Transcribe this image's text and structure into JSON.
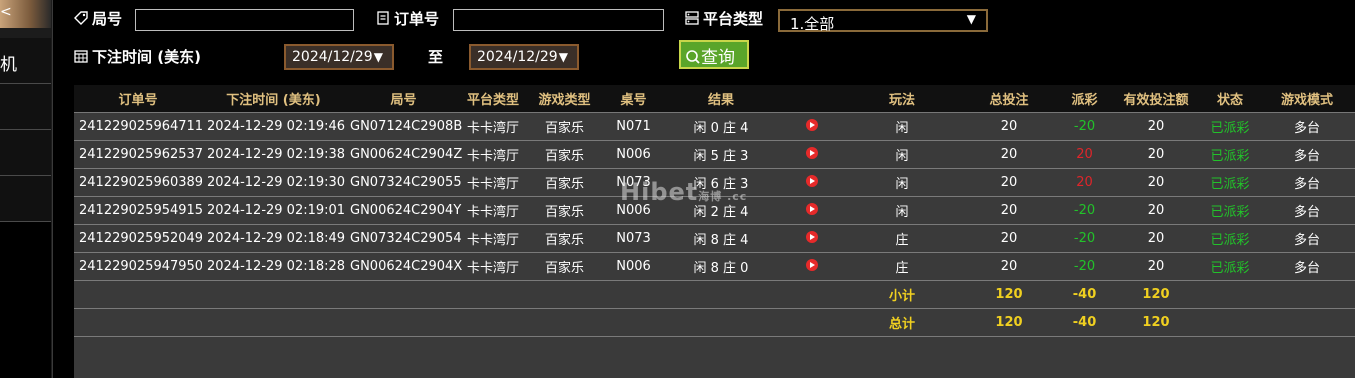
{
  "sidebar": {
    "item1": "机",
    "top_arrow": "<"
  },
  "filters": {
    "game_no_label": "局号",
    "order_no_label": "订单号",
    "platform_label": "平台类型",
    "platform_value": "1.全部",
    "bet_time_label": "下注时间 (美东)",
    "date_from": "2024/12/29",
    "to_label": "至",
    "date_to": "2024/12/29",
    "query_label": "查询"
  },
  "table": {
    "headers": [
      "订单号",
      "下注时间 (美东)",
      "局号",
      "平台类型",
      "游戏类型",
      "桌号",
      "结果",
      "",
      "玩法",
      "总投注",
      "派彩",
      "有效投注额",
      "状态",
      "游戏模式"
    ],
    "rows": [
      {
        "order": "241229025964711",
        "time": "2024-12-29 02:19:46",
        "game": "GN07124C2908B",
        "platform": "卡卡湾厅",
        "type": "百家乐",
        "table": "N071",
        "result": "闲 0 庄 4",
        "play": "闲",
        "bet": "20",
        "payout": "-20",
        "payout_color": "green",
        "valid": "20",
        "status": "已派彩",
        "mode": "多台"
      },
      {
        "order": "241229025962537",
        "time": "2024-12-29 02:19:38",
        "game": "GN00624C2904Z",
        "platform": "卡卡湾厅",
        "type": "百家乐",
        "table": "N006",
        "result": "闲 5 庄 3",
        "play": "闲",
        "bet": "20",
        "payout": "20",
        "payout_color": "red",
        "valid": "20",
        "status": "已派彩",
        "mode": "多台"
      },
      {
        "order": "241229025960389",
        "time": "2024-12-29 02:19:30",
        "game": "GN07324C29055",
        "platform": "卡卡湾厅",
        "type": "百家乐",
        "table": "N073",
        "result": "闲 6 庄 3",
        "play": "闲",
        "bet": "20",
        "payout": "20",
        "payout_color": "red",
        "valid": "20",
        "status": "已派彩",
        "mode": "多台"
      },
      {
        "order": "241229025954915",
        "time": "2024-12-29 02:19:01",
        "game": "GN00624C2904Y",
        "platform": "卡卡湾厅",
        "type": "百家乐",
        "table": "N006",
        "result": "闲 2 庄 4",
        "play": "闲",
        "bet": "20",
        "payout": "-20",
        "payout_color": "green",
        "valid": "20",
        "status": "已派彩",
        "mode": "多台"
      },
      {
        "order": "241229025952049",
        "time": "2024-12-29 02:18:49",
        "game": "GN07324C29054",
        "platform": "卡卡湾厅",
        "type": "百家乐",
        "table": "N073",
        "result": "闲 8 庄 4",
        "play": "庄",
        "bet": "20",
        "payout": "-20",
        "payout_color": "green",
        "valid": "20",
        "status": "已派彩",
        "mode": "多台"
      },
      {
        "order": "241229025947950",
        "time": "2024-12-29 02:18:28",
        "game": "GN00624C2904X",
        "platform": "卡卡湾厅",
        "type": "百家乐",
        "table": "N006",
        "result": "闲 8 庄 0",
        "play": "庄",
        "bet": "20",
        "payout": "-20",
        "payout_color": "green",
        "valid": "20",
        "status": "已派彩",
        "mode": "多台"
      }
    ],
    "subtotal": {
      "label": "小计",
      "bet": "120",
      "payout": "-40",
      "valid": "120"
    },
    "total": {
      "label": "总计",
      "bet": "120",
      "payout": "-40",
      "valid": "120"
    }
  },
  "watermark": {
    "brand": "Hibet",
    "suffix": "海博 .cc"
  },
  "colors": {
    "accent_gold": "#e0c080",
    "status_green": "#22c22a",
    "payout_red": "#e0252a",
    "query_green": "#5aa52a"
  }
}
